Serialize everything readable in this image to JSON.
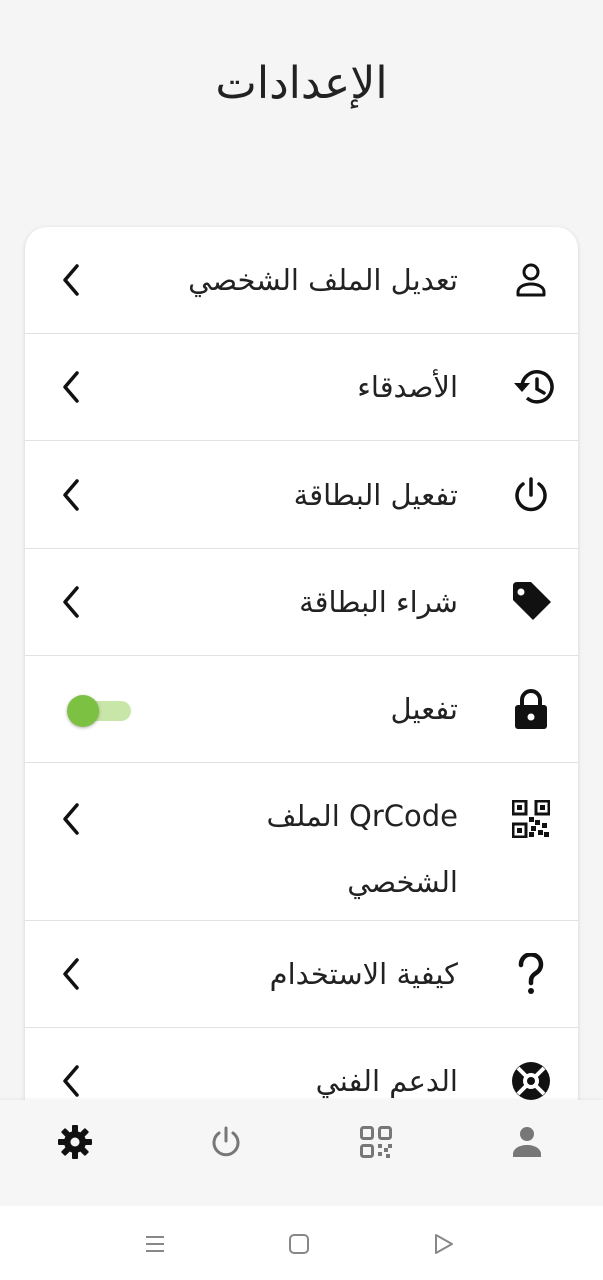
{
  "header": {
    "title": "الإعدادات"
  },
  "settings": {
    "items": [
      {
        "label": "تعديل الملف الشخصي",
        "icon": "person-outline-icon"
      },
      {
        "label": "الأصدقاء",
        "icon": "history-icon"
      },
      {
        "label": "تفعيل البطاقة",
        "icon": "power-icon"
      },
      {
        "label": "شراء البطاقة",
        "icon": "tag-icon"
      },
      {
        "label": "تفعيل",
        "icon": "lock-icon",
        "toggle_on": true
      },
      {
        "label": "QrCode الملف الشخصي",
        "icon": "qrcode-icon"
      },
      {
        "label": "كيفية الاستخدام",
        "icon": "question-icon"
      },
      {
        "label": "الدعم الفني",
        "icon": "lifebuoy-icon"
      }
    ]
  },
  "bottom_nav": {
    "items": [
      {
        "icon": "gear-icon",
        "active": true
      },
      {
        "icon": "power-icon",
        "active": false
      },
      {
        "icon": "qrcode-icon",
        "active": false
      },
      {
        "icon": "person-icon",
        "active": false
      }
    ]
  },
  "system_nav": {
    "icons": [
      "recents-icon",
      "home-icon",
      "back-icon"
    ]
  },
  "colors": {
    "accent": "#7cc142",
    "accent_light": "#c8e6a8",
    "text": "#222222",
    "inactive": "#777777"
  }
}
